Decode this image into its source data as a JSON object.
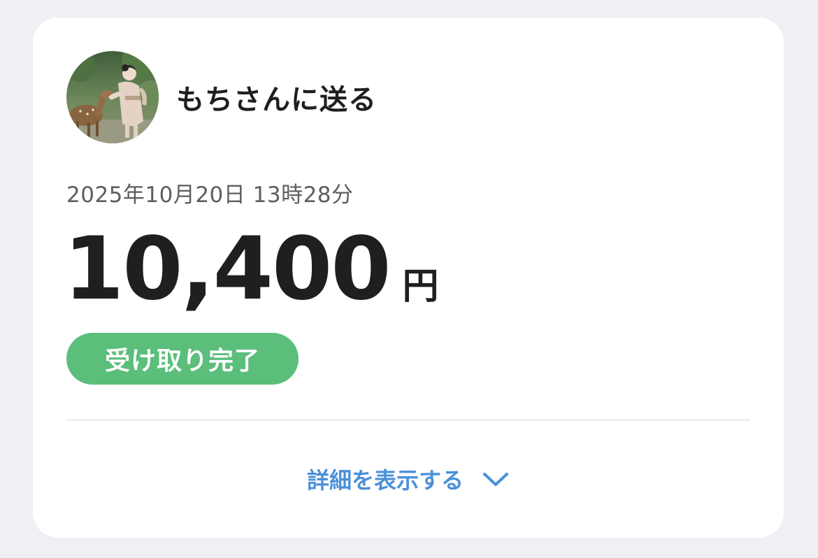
{
  "recipient": {
    "title": "もちさんに送る",
    "avatar_alt": "avatar"
  },
  "transaction": {
    "datetime": "2025年10月20日 13時28分",
    "amount": "10,400",
    "currency": "円",
    "status": "受け取り完了"
  },
  "details": {
    "label": "詳細を表示する",
    "icon": "chevron-down-icon"
  },
  "colors": {
    "background": "#eff0f4",
    "card": "#ffffff",
    "status_green": "#5bbe7b",
    "link_blue": "#4a90d9",
    "text_dark": "#1f1f1f",
    "text_gray": "#5e5e5e"
  }
}
